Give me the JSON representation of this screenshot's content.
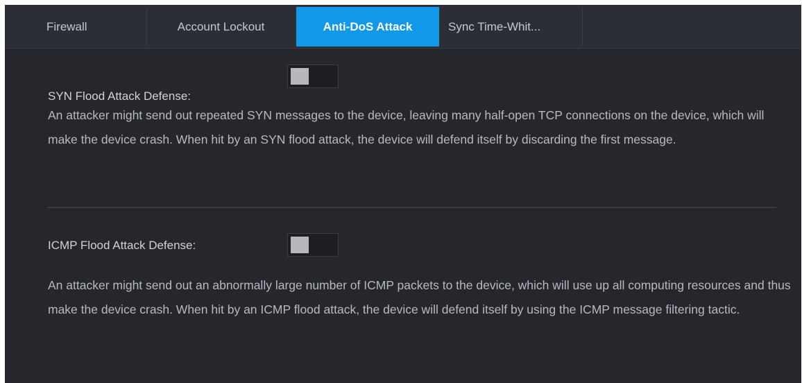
{
  "tabs": [
    {
      "label": "Firewall",
      "active": false
    },
    {
      "label": "Account Lockout",
      "active": false
    },
    {
      "label": "Anti-DoS Attack",
      "active": true
    },
    {
      "label": "Sync Time-Whit...",
      "active": false
    }
  ],
  "syn": {
    "label": "SYN Flood Attack Defense:",
    "enabled": false,
    "description": "An attacker might send out repeated SYN messages to the device, leaving many half-open TCP connections on the device, which will make the device crash. When hit by an SYN flood attack, the device will defend itself by discarding the first message."
  },
  "icmp": {
    "label": "ICMP Flood Attack Defense:",
    "enabled": false,
    "description": "An attacker might send out an abnormally large number of ICMP packets to the device, which will use up all computing resources and thus make the device crash. When hit by an ICMP flood attack, the device will defend itself by using the ICMP message filtering tactic."
  },
  "colors": {
    "panel_bg": "#25272d",
    "tab_active_bg": "#1198e9",
    "text": "#c6c8cd"
  }
}
